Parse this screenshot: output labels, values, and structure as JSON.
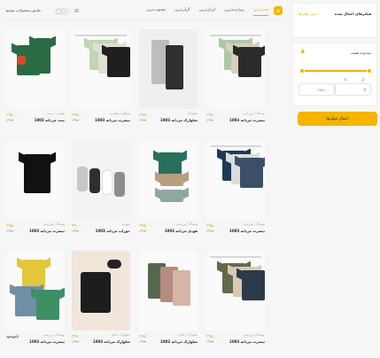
{
  "filters": {
    "title": "فیلترهای اعمال شده",
    "clear": "حذف فیلترها"
  },
  "price": {
    "title": "محدوده قیمت",
    "from": "از",
    "to": "تا",
    "min": "0",
    "max": "۲۸۹,۰۰۰"
  },
  "apply": "اعمال فیلترها",
  "topbar": {
    "tabs": [
      "جدیدترین",
      "پربازدیدترین",
      "ارزان‌ترین",
      "گران‌ترین",
      "محبوب‌ترین"
    ],
    "only_available": "نمایش محصولات موجود"
  },
  "currency": "تومان",
  "products": [
    {
      "meta": "پوشاک / ورزشی",
      "name": "تیشرت مردانه 1003",
      "price": "۳۹۵,۰۰۰"
    },
    {
      "meta": "شلوارک",
      "name": "شلوارک مردانه 1003",
      "price": "۳۹۵,۰۰۰"
    },
    {
      "meta": "پیراهن / تیشرت",
      "name": "تیشرت مردانه 1003",
      "price": "۳۲۵,۰۰۰"
    },
    {
      "meta": "تیشرت / ست",
      "name": "ست مردانه 1003",
      "price": "۳۹۵,۰۰۰"
    },
    {
      "meta": "پوشاک / ورزشی",
      "name": "تیشرت مردانه 1003",
      "price": "۲۹۵,۰۰۰"
    },
    {
      "meta": "پوشاک / ورزشی",
      "name": "هودی مردانه 1003",
      "price": "۳۹۵,۰۰۰"
    },
    {
      "meta": "جوراب",
      "name": "جوراب مردانه 1003",
      "price": "۹۹,۰۰۰"
    },
    {
      "meta": "پوشاک / ورزشی",
      "name": "تیشرت مردانه 1003",
      "price": "۲۹۵,۰۰۰"
    },
    {
      "meta": "پوشاک / ورزشی",
      "name": "تیشرت مردانه 1003",
      "price": "۳۹۵,۰۰۰"
    },
    {
      "meta": "شلوارک / کتان",
      "name": "شلوارک مردانه 1003",
      "price": "۲۹۵,۰۰۰"
    },
    {
      "meta": "شلوارک / کتان",
      "name": "شلوارک مردانه 1003",
      "price": "۳۴۹,۰۰۰"
    },
    {
      "meta": "پوشاک / ورزشی",
      "name": "تیشرت مردانه 1003",
      "sold_out": "ناموجود"
    }
  ],
  "colors": {
    "accent": "#f5b400"
  }
}
